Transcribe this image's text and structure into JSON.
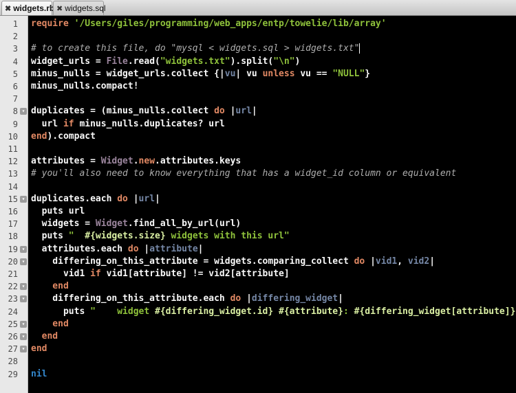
{
  "tabs": [
    {
      "label": "widgets.rb",
      "active": true
    },
    {
      "label": "widgets.sql",
      "active": false
    }
  ],
  "colors": {
    "default": "#f8f8f8",
    "keyword": "#e28964",
    "string": "#8fc23b",
    "comment": "#aeaeae",
    "constant": "#9b859d",
    "param": "#7587a6",
    "interp": "#daefa3",
    "nil": "#3387cc"
  },
  "editor": {
    "fold_lines": [
      8,
      15,
      19,
      20,
      22,
      23,
      25,
      26,
      27
    ],
    "cursor_line": 3,
    "lines": [
      [
        [
          "kw",
          "require"
        ],
        [
          "d",
          " "
        ],
        [
          "str",
          "'/Users/giles/programming/web_apps/entp/towelie/lib/array'"
        ]
      ],
      [],
      [
        [
          "cmt",
          "# to create this file, do \"mysql < widgets.sql > widgets.txt\""
        ]
      ],
      [
        [
          "d",
          "widget_urls = "
        ],
        [
          "const",
          "File"
        ],
        [
          "d",
          ".read("
        ],
        [
          "str",
          "\"widgets.txt\""
        ],
        [
          "d",
          ").split("
        ],
        [
          "str",
          "\"\\n\""
        ],
        [
          "d",
          ")"
        ]
      ],
      [
        [
          "d",
          "minus_nulls = widget_urls.collect {|"
        ],
        [
          "par",
          "vu"
        ],
        [
          "d",
          "| vu "
        ],
        [
          "kw",
          "unless"
        ],
        [
          "d",
          " vu == "
        ],
        [
          "str",
          "\"NULL\""
        ],
        [
          "d",
          "}"
        ]
      ],
      [
        [
          "d",
          "minus_nulls.compact!"
        ]
      ],
      [],
      [
        [
          "d",
          "duplicates = (minus_nulls.collect "
        ],
        [
          "kw",
          "do"
        ],
        [
          "d",
          " |"
        ],
        [
          "par",
          "url"
        ],
        [
          "d",
          "|"
        ]
      ],
      [
        [
          "d",
          "  url "
        ],
        [
          "kw",
          "if"
        ],
        [
          "d",
          " minus_nulls.duplicates? url"
        ]
      ],
      [
        [
          "kw",
          "end"
        ],
        [
          "d",
          ").compact"
        ]
      ],
      [],
      [
        [
          "d",
          "attributes = "
        ],
        [
          "const",
          "Widget"
        ],
        [
          "d",
          "."
        ],
        [
          "kw",
          "new"
        ],
        [
          "d",
          ".attributes.keys"
        ]
      ],
      [
        [
          "cmt",
          "# you'll also need to know everything that has a widget_id column or equivalent"
        ]
      ],
      [],
      [
        [
          "d",
          "duplicates.each "
        ],
        [
          "kw",
          "do"
        ],
        [
          "d",
          " |"
        ],
        [
          "par",
          "url"
        ],
        [
          "d",
          "|"
        ]
      ],
      [
        [
          "d",
          "  puts url"
        ]
      ],
      [
        [
          "d",
          "  widgets = "
        ],
        [
          "const",
          "Widget"
        ],
        [
          "d",
          ".find_all_by_url(url)"
        ]
      ],
      [
        [
          "d",
          "  puts "
        ],
        [
          "str",
          "\"  "
        ],
        [
          "int",
          "#{widgets.size}"
        ],
        [
          "str",
          " widgets with this url\""
        ]
      ],
      [
        [
          "d",
          "  attributes.each "
        ],
        [
          "kw",
          "do"
        ],
        [
          "d",
          " |"
        ],
        [
          "par",
          "attribute"
        ],
        [
          "d",
          "|"
        ]
      ],
      [
        [
          "d",
          "    differing_on_this_attribute = widgets.comparing_collect "
        ],
        [
          "kw",
          "do"
        ],
        [
          "d",
          " |"
        ],
        [
          "par",
          "vid1"
        ],
        [
          "d",
          ", "
        ],
        [
          "par",
          "vid2"
        ],
        [
          "d",
          "|"
        ]
      ],
      [
        [
          "d",
          "      vid1 "
        ],
        [
          "kw",
          "if"
        ],
        [
          "d",
          " vid1[attribute] != vid2[attribute]"
        ]
      ],
      [
        [
          "kw",
          "    end"
        ]
      ],
      [
        [
          "d",
          "    differing_on_this_attribute.each "
        ],
        [
          "kw",
          "do"
        ],
        [
          "d",
          " |"
        ],
        [
          "par",
          "differing_widget"
        ],
        [
          "d",
          "|"
        ]
      ],
      [
        [
          "d",
          "      puts "
        ],
        [
          "str",
          "\"    widget "
        ],
        [
          "int",
          "#{differing_widget.id}"
        ],
        [
          "str",
          " "
        ],
        [
          "int",
          "#{attribute}"
        ],
        [
          "str",
          ": "
        ],
        [
          "int",
          "#{differing_widget[attribute]}"
        ],
        [
          "str",
          "\""
        ]
      ],
      [
        [
          "kw",
          "    end"
        ]
      ],
      [
        [
          "kw",
          "  end"
        ]
      ],
      [
        [
          "kw",
          "end"
        ]
      ],
      [],
      [
        [
          "nil",
          "nil"
        ]
      ]
    ]
  }
}
